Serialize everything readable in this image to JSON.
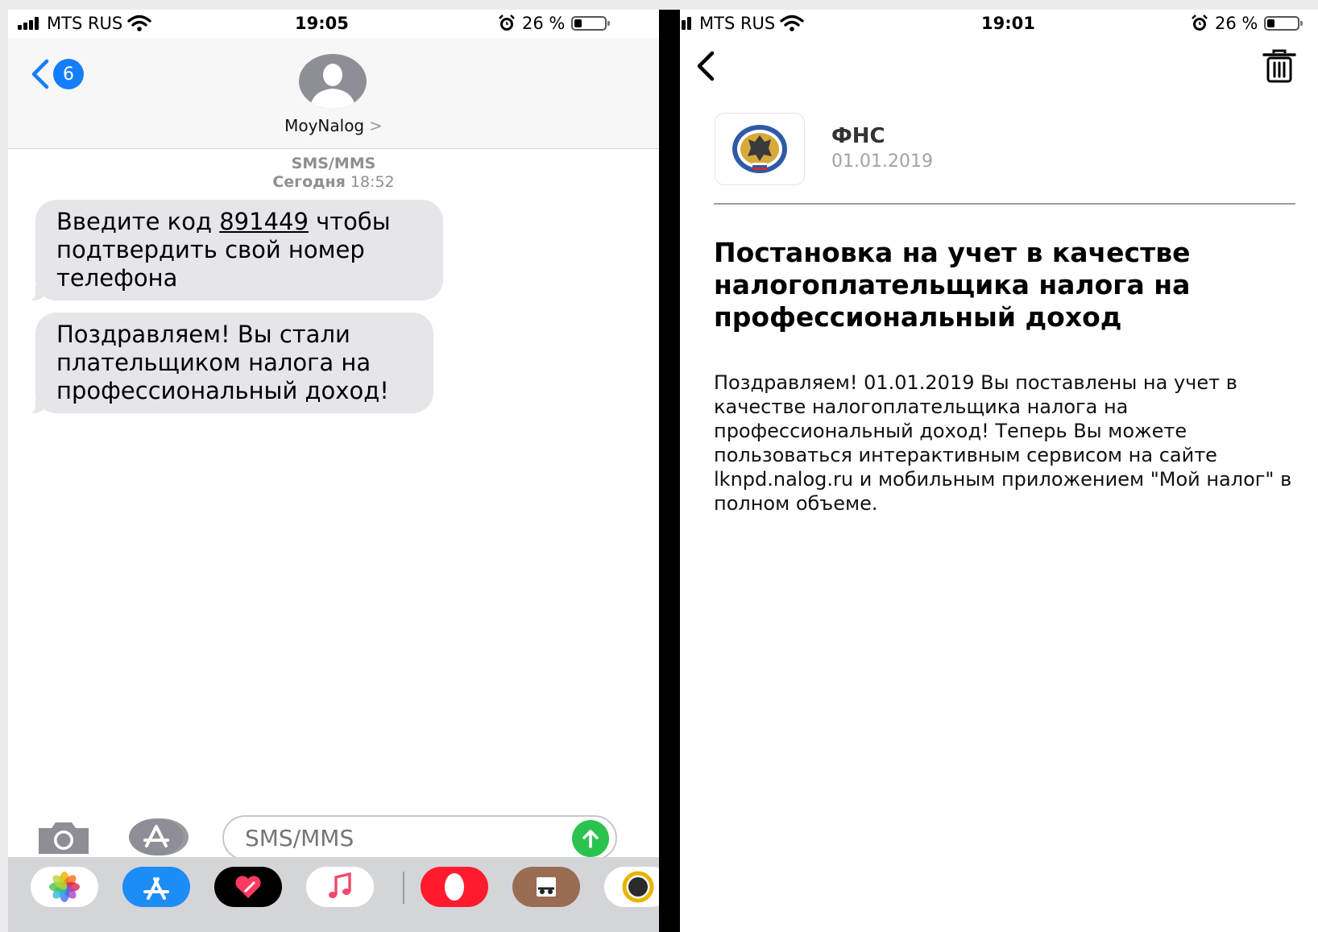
{
  "sms_screen": {
    "status": {
      "carrier": "MTS RUS",
      "time": "19:05",
      "battery": "26 %",
      "battery_level": 0.26
    },
    "header": {
      "back_badge": "6",
      "contact_name": "MoyNalog",
      "chevron": ">"
    },
    "thread_meta": {
      "service": "SMS/MMS",
      "date_label": "Сегодня",
      "time": "18:52"
    },
    "messages": [
      {
        "pre": "Введите код ",
        "code": "891449",
        "post": " чтобы подтвердить свой номер телефона"
      },
      {
        "text": "Поздравляем! Вы стали плательщиком налога на профессиональный доход!"
      }
    ],
    "composer": {
      "placeholder": "SMS/MMS"
    }
  },
  "notification_screen": {
    "status": {
      "carrier": "MTS RUS",
      "time": "19:01",
      "battery": "26 %",
      "battery_level": 0.26
    },
    "sender": {
      "name": "ФНС",
      "date": "01.01.2019"
    },
    "title": "Постановка на учет в качестве налогоплательщика налога на профессиональный доход",
    "body": "Поздравляем! 01.01.2019 Вы поставлены на учет в качестве налогоплательщика налога на профессиональный доход! Теперь Вы можете пользоваться интерактивным сервисом на сайте lknpd.nalog.ru и мобильным приложением \"Мой налог\" в полном объеме."
  },
  "icons": {
    "signal": "signal-icon",
    "wifi": "wifi-icon",
    "alarm": "alarm-icon",
    "battery": "battery-icon",
    "back": "chevron-left-icon",
    "camera": "camera-icon",
    "app_store": "app-store-icon",
    "send": "arrow-up-icon",
    "trash": "trash-icon",
    "fns_logo": "fns-emblem-icon"
  },
  "colors": {
    "ios_blue": "#147efb",
    "send_green": "#2bc34f",
    "bubble_gray": "#e5e5ea",
    "meta_gray": "#8e8e93"
  }
}
